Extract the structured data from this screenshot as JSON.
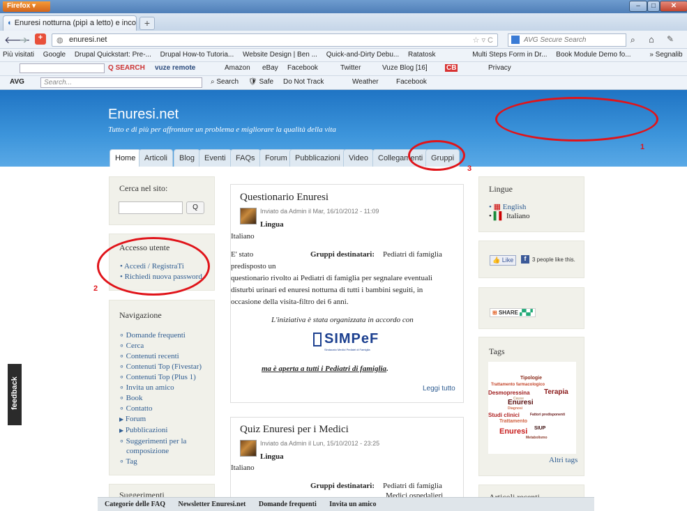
{
  "window": {
    "app_button": "Firefox",
    "minimize": "–",
    "maximize": "□",
    "close": "✕"
  },
  "tabs": [
    {
      "label": "Enuresi notturna (pipì a letto) e incontin..."
    }
  ],
  "newtab_label": "+",
  "nav": {
    "url": "enuresi.net",
    "search_placeholder": "AVG Secure Search"
  },
  "bookmarks": [
    "Più visitati",
    "Google",
    "Drupal Quickstart: Pre-...",
    "Drupal How-to Tutoria...",
    "Website Design | Ben ...",
    "Quick-and-Dirty Debu...",
    "Ratatosk",
    "Multi Steps Form in Dr...",
    "Book Module Demo fo...",
    "» Segnalib"
  ],
  "toolbar2": {
    "search": "SEARCH",
    "vuze": "vuze remote",
    "amazon": "Amazon",
    "ebay": "eBay",
    "facebook": "Facebook",
    "twitter": "Twitter",
    "vuzeblog": "Vuze Blog [16]",
    "cb": "CB",
    "privacy": "Privacy"
  },
  "toolbar3": {
    "avg": "AVG",
    "search_placeholder": "Search...",
    "search": "Search",
    "safe": "Safe",
    "dnt": "Do Not Track",
    "weather": "Weather",
    "facebook": "Facebook"
  },
  "site": {
    "title": "Enuresi.net",
    "slogan": "Tutto e di più per affrontare un problema e migliorare la qualità della vita"
  },
  "primary_tabs": [
    "Home",
    "Articoli",
    "Blog",
    "Eventi",
    "FAQs",
    "Forum",
    "Pubblicazioni",
    "Video",
    "Collegamenti",
    "Gruppi"
  ],
  "search_block": {
    "title": "Cerca nel sito:",
    "button": "Q"
  },
  "login_block": {
    "title": "Accesso utente",
    "links": [
      "Accedi / RegistraTi",
      "Richiedi nuova password"
    ]
  },
  "navigation_block": {
    "title": "Navigazione",
    "links": [
      "Domande frequenti",
      "Cerca",
      "Contenuti recenti",
      "Contenuti Top (Fivestar)",
      "Contenuti Top (Plus 1)",
      "Invita un amico",
      "Book",
      "Contatto",
      "Forum",
      "Pubblicazioni",
      "Suggerimenti per la composizione",
      "Tag"
    ]
  },
  "suggestions_block": {
    "title": "Suggerimenti"
  },
  "node1": {
    "title": "Questionario Enuresi",
    "meta": "Inviato da Admin il Mar, 16/10/2012 - 11:09",
    "lingua_label": "Lingua",
    "lingua": "Italiano",
    "col1": "E' stato predisposto un",
    "gruppi_label": "Gruppi destinatari:",
    "gruppi": "Pediatri di famiglia",
    "body": "questionario rivolto ai Pediatri di famiglia per segnalare eventuali disturbi urinari ed enuresi notturna di tutti i bambini seguiti, in occasione della visita-filtro dei 6 anni.",
    "italic": "L'iniziativa è stata organizzata in accordo con",
    "logo": "SIMPeF",
    "logo_sub": "Sindacato Medici Pediatri di Famiglia",
    "underline": "ma è aperta a tutti i Pediatri di famiglia",
    "underline_end": ".",
    "readmore": "Leggi tutto"
  },
  "node2": {
    "title": "Quiz Enuresi per i Medici",
    "meta": "Inviato da Admin il Lun, 15/10/2012 - 23:25",
    "lingua_label": "Lingua",
    "lingua": "Italiano",
    "gruppi_label": "Gruppi destinatari:",
    "gruppi": "Pediatri di famiglia",
    "gruppi2": "Medici ospedalieri"
  },
  "lingue_block": {
    "title": "Lingue",
    "items": [
      "English",
      "Italiano"
    ]
  },
  "like_block": {
    "like": "Like",
    "text": "3 people like this."
  },
  "share_block": {
    "label": "SHARE"
  },
  "tags_block": {
    "title": "Tags",
    "more": "Altri tags",
    "words": [
      "Tipologie",
      "Trattamento farmacologico",
      "Desmopressina",
      "Terapia",
      "Cause",
      "Enuresi",
      "Diagnosi",
      "Studi clinici",
      "Fattori predisponenti",
      "Trattamento",
      "SIUP",
      "Enuresi",
      "Metabolismo"
    ]
  },
  "bottom_block": {
    "title": "Articoli recenti"
  },
  "footer": [
    "Categorie delle FAQ",
    "Newsletter Enuresi.net",
    "Domande frequenti",
    "Invita un amico"
  ],
  "feedback": "feedback",
  "annotations": [
    "1",
    "2",
    "3"
  ]
}
